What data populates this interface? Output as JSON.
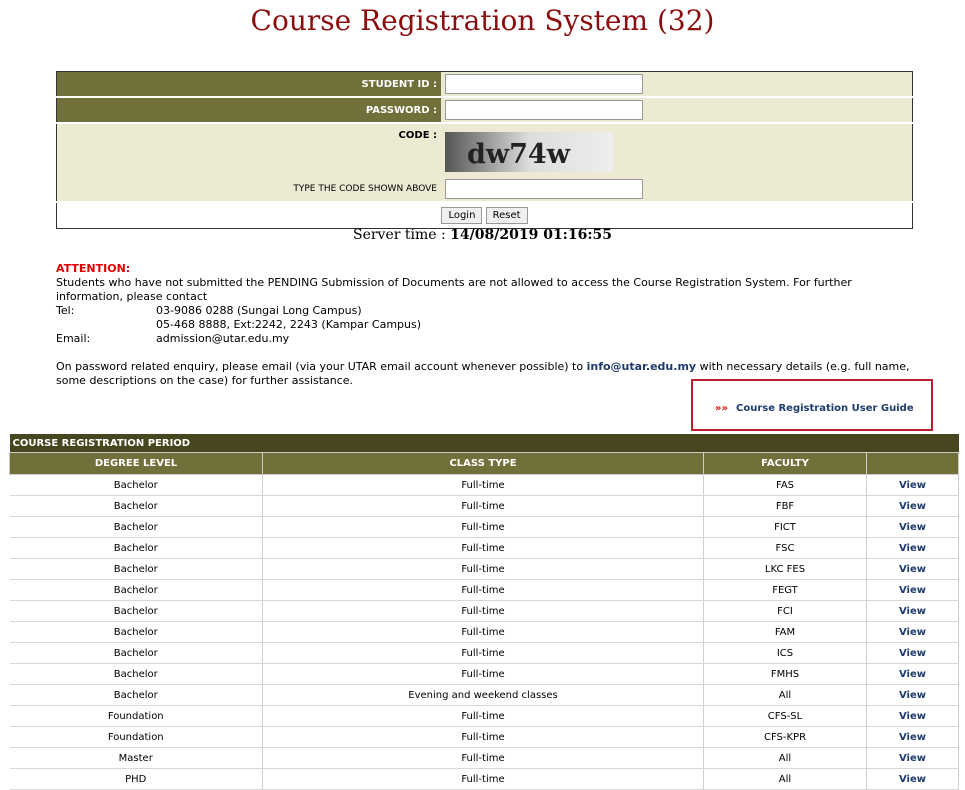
{
  "title": "Course Registration System (32)",
  "login": {
    "student_id_label": "STUDENT ID :",
    "password_label": "PASSWORD :",
    "code_label": "CODE :",
    "captcha_text": "dw74w",
    "type_code_label": "TYPE THE CODE SHOWN ABOVE",
    "login_btn": "Login",
    "reset_btn": "Reset"
  },
  "server_time_label": "Server time : ",
  "server_time_value": "14/08/2019 01:16:55",
  "notice": {
    "attention": "ATTENTION:",
    "text": "Students who have not submitted the PENDING Submission of Documents are not allowed to access the Course Registration System. For further information, please contact",
    "tel_label": "Tel:",
    "tel1": "03-9086 0288 (Sungai Long Campus)",
    "tel2": "05-468 8888, Ext:2242, 2243 (Kampar Campus)",
    "email_label": "Email:",
    "email": "admission@utar.edu.my",
    "pw_pre": "On password related enquiry, please email (via your UTAR email account whenever possible) to ",
    "pw_email": "info@utar.edu.my",
    "pw_post": " with necessary details (e.g. full name, some descriptions on the case) for further assistance."
  },
  "guide": {
    "arrows": "»»",
    "label": "Course Registration User Guide"
  },
  "period": {
    "caption": "COURSE REGISTRATION PERIOD",
    "headers": [
      "DEGREE LEVEL",
      "CLASS TYPE",
      "FACULTY",
      ""
    ],
    "rows": [
      [
        "Bachelor",
        "Full-time",
        "FAS",
        "View"
      ],
      [
        "Bachelor",
        "Full-time",
        "FBF",
        "View"
      ],
      [
        "Bachelor",
        "Full-time",
        "FICT",
        "View"
      ],
      [
        "Bachelor",
        "Full-time",
        "FSC",
        "View"
      ],
      [
        "Bachelor",
        "Full-time",
        "LKC FES",
        "View"
      ],
      [
        "Bachelor",
        "Full-time",
        "FEGT",
        "View"
      ],
      [
        "Bachelor",
        "Full-time",
        "FCI",
        "View"
      ],
      [
        "Bachelor",
        "Full-time",
        "FAM",
        "View"
      ],
      [
        "Bachelor",
        "Full-time",
        "ICS",
        "View"
      ],
      [
        "Bachelor",
        "Full-time",
        "FMHS",
        "View"
      ],
      [
        "Bachelor",
        "Evening and weekend classes",
        "All",
        "View"
      ],
      [
        "Foundation",
        "Full-time",
        "CFS-SL",
        "View"
      ],
      [
        "Foundation",
        "Full-time",
        "CFS-KPR",
        "View"
      ],
      [
        "Master",
        "Full-time",
        "All",
        "View"
      ],
      [
        "PHD",
        "Full-time",
        "All",
        "View"
      ]
    ]
  },
  "colors": {
    "title": "#8b0d0d",
    "header_olive": "#716f3a",
    "caption_dark": "#48461f",
    "form_bg": "#ecead2",
    "attention": "#e00000",
    "link": "#1f3b6e"
  }
}
